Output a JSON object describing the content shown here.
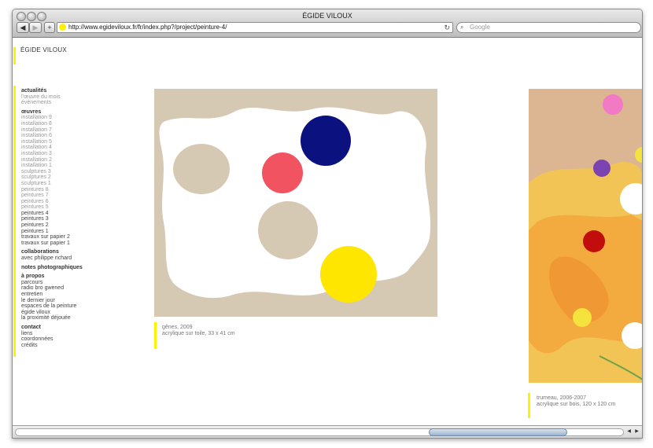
{
  "window": {
    "title": "ÉGIDE VILOUX"
  },
  "toolbar": {
    "back_label": "◀",
    "forward_label": "▶",
    "add_label": "+",
    "url": "http://www.egideviloux.fr/fr/index.php?/project/peinture-4/",
    "reload_label": "↻",
    "search_placeholder": "Google",
    "search_icon": "⌕"
  },
  "site": {
    "title": "ÉGIDE VILOUX"
  },
  "nav": [
    {
      "heading": "actualités",
      "items": [
        {
          "label": "l'œuvre du mois",
          "dark": false
        },
        {
          "label": "évènements",
          "dark": false
        }
      ]
    },
    {
      "heading": "œuvres",
      "items": [
        {
          "label": "installation 9",
          "dark": false
        },
        {
          "label": "installation 8",
          "dark": false
        },
        {
          "label": "installation 7",
          "dark": false
        },
        {
          "label": "installation 6",
          "dark": false
        },
        {
          "label": "installation 5",
          "dark": false
        },
        {
          "label": "installation 4",
          "dark": false
        },
        {
          "label": "installation 3",
          "dark": false
        },
        {
          "label": "installation 2",
          "dark": false
        },
        {
          "label": "installation 1",
          "dark": false
        },
        {
          "label": "sculptures 3",
          "dark": false
        },
        {
          "label": "sculptures 2",
          "dark": false
        },
        {
          "label": "sculptures 1",
          "dark": false
        },
        {
          "label": "peintures 8",
          "dark": false
        },
        {
          "label": "peintures 7",
          "dark": false
        },
        {
          "label": "peintures 6",
          "dark": false
        },
        {
          "label": "peintures 5",
          "dark": false
        },
        {
          "label": "peintures 4",
          "dark": true
        },
        {
          "label": "peintures 3",
          "dark": true
        },
        {
          "label": "peintures 2",
          "dark": true
        },
        {
          "label": "peintures 1",
          "dark": true
        },
        {
          "label": "travaux sur papier 2",
          "dark": true
        },
        {
          "label": "travaux sur papier 1",
          "dark": true
        }
      ]
    },
    {
      "heading": "collaborations",
      "items": [
        {
          "label": "avec philippe richard",
          "dark": true
        }
      ]
    },
    {
      "heading": "notes photographiques",
      "items": []
    },
    {
      "heading": "à propos",
      "items": [
        {
          "label": "parcours",
          "dark": true
        },
        {
          "label": "radio bro gwened",
          "dark": true
        },
        {
          "label": "entretien",
          "dark": true
        },
        {
          "label": "le dernier jour",
          "dark": true
        },
        {
          "label": "espaces de la peinture",
          "dark": true
        },
        {
          "label": "égide viloux",
          "dark": true
        },
        {
          "label": "la proximité déjouée",
          "dark": true
        }
      ]
    },
    {
      "heading": "contact",
      "items": [
        {
          "label": "liens",
          "dark": true
        },
        {
          "label": "coordonnées",
          "dark": true
        },
        {
          "label": "crédits",
          "dark": true
        }
      ]
    }
  ],
  "works": [
    {
      "caption_line1": "gênes, 2009",
      "caption_line2": "acrylique sur toile, 33 x 41 cm"
    },
    {
      "caption_line1": "trumeau, 2006-2007",
      "caption_line2": "acrylique sur bois, 120 x 120 cm"
    }
  ],
  "colors": {
    "accent": "#fff200",
    "canvas": "#d6c9b3",
    "blue": "#0b1280",
    "red": "#f25361",
    "yellow": "#ffe600"
  }
}
